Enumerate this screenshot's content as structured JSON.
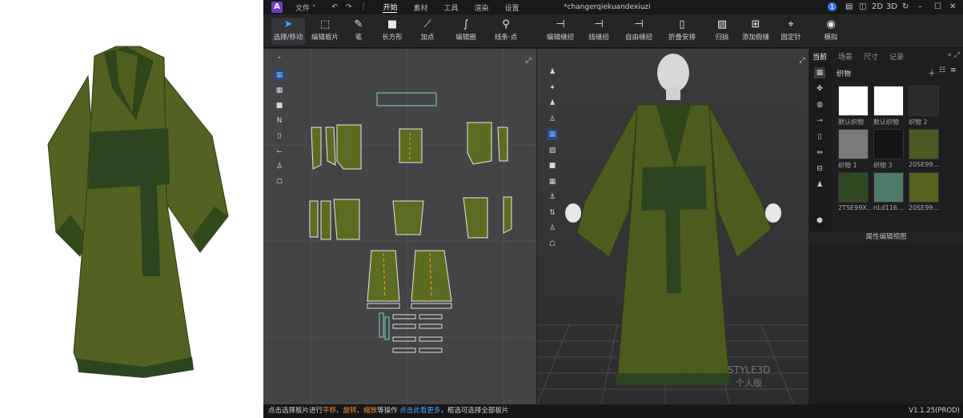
{
  "app": {
    "logo": "A",
    "title": "*changerqiekuandexiuzi"
  },
  "menu": {
    "file": "文件 ˅",
    "start": "开始",
    "material": "素材",
    "tools": "工具",
    "render": "渲染",
    "settings": "设置"
  },
  "window_controls": {
    "badge": "1",
    "d2": "2D",
    "d3": "3D"
  },
  "toolbar": [
    {
      "label": "选择/移动",
      "icon": "pointer-icon",
      "glyph": "➤"
    },
    {
      "label": "编辑板片",
      "icon": "edit-pattern-icon",
      "glyph": "⬚"
    },
    {
      "label": "笔",
      "icon": "pen-icon",
      "glyph": "✎"
    },
    {
      "label": "长方形",
      "icon": "rectangle-icon",
      "glyph": "■"
    },
    {
      "label": "加点",
      "icon": "add-point-icon",
      "glyph": "⟋"
    },
    {
      "label": "编辑圈",
      "icon": "edit-curve-icon",
      "glyph": "∫"
    },
    {
      "label": "线条·点",
      "icon": "line-point-icon",
      "glyph": "⚲"
    },
    {
      "label": "编辑缝纫",
      "icon": "edit-sewing-icon",
      "glyph": "⊣"
    },
    {
      "label": "线缝纫",
      "icon": "seam-sewing-icon",
      "glyph": "⊣"
    },
    {
      "label": "自由缝纫",
      "icon": "free-sewing-icon",
      "glyph": "⊣"
    },
    {
      "label": "折叠安排",
      "icon": "fold-arrange-icon",
      "glyph": "▯"
    },
    {
      "label": "归拢",
      "icon": "gather-icon",
      "glyph": "▨"
    },
    {
      "label": "添加假缝",
      "icon": "tack-icon",
      "glyph": "⊞"
    },
    {
      "label": "固定针",
      "icon": "pin-icon",
      "glyph": "⌖"
    },
    {
      "label": "模拟",
      "icon": "simulate-icon",
      "glyph": "◉"
    }
  ],
  "right_panel": {
    "tabs": [
      "当前",
      "场景",
      "尺寸",
      "记录"
    ],
    "section_label": "织物",
    "fabrics": [
      {
        "label": "默认织物",
        "color": "#ffffff"
      },
      {
        "label": "默认织物",
        "color": "#ffffff"
      },
      {
        "label": "织物 2",
        "color": "#2b2b2d"
      },
      {
        "label": "织物 1",
        "color": "#7a7a7a"
      },
      {
        "label": "织物 3",
        "color": "#151517"
      },
      {
        "label": "20SE99...",
        "color": "#4b5a22"
      },
      {
        "label": "2TSE99X...",
        "color": "#2f4a22"
      },
      {
        "label": "nLd116...",
        "color": "#4e7a6a"
      },
      {
        "label": "20SE99...",
        "color": "#55631f"
      }
    ],
    "editor_label": "属性编辑视图"
  },
  "status": {
    "p1": "点击选择板片进行",
    "o1": "平移",
    "p2": "、",
    "o2": "旋转",
    "p3": "、",
    "o3": "缩放",
    "p4": "等操作 ",
    "b1": "点击此看更多",
    "p5": "，框选可选择全部板片",
    "version": "V1.1.25(PROD)"
  },
  "watermark": {
    "line1": "STYLE3D",
    "line2": "个人版"
  },
  "colors": {
    "accent": "#4aa3ff",
    "fabric_green": "#4d5c1c",
    "sash_green": "#2a4520",
    "highlight": "#ff8a2a"
  }
}
